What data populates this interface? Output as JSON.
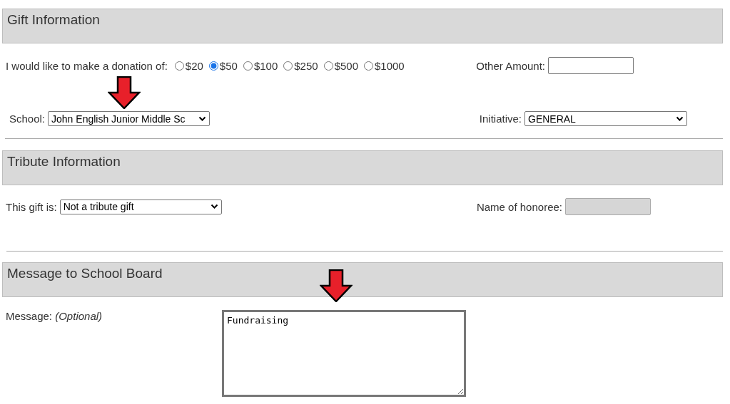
{
  "gift": {
    "title": "Gift Information",
    "donation": {
      "label": "I would like to make a donation of:",
      "options": [
        {
          "label": "$20",
          "selected": false
        },
        {
          "label": "$50",
          "selected": true
        },
        {
          "label": "$100",
          "selected": false
        },
        {
          "label": "$250",
          "selected": false
        },
        {
          "label": "$500",
          "selected": false
        },
        {
          "label": "$1000",
          "selected": false
        }
      ]
    },
    "other_amount": {
      "label": "Other Amount:"
    },
    "school": {
      "label": "School:",
      "value": "John English Junior Middle Sc"
    },
    "initiative": {
      "label": "Initiative:",
      "value": "GENERAL"
    }
  },
  "tribute": {
    "title": "Tribute Information",
    "gift_type": {
      "label": "This gift is:",
      "value": "Not a tribute gift"
    },
    "honoree": {
      "label": "Name of honoree:",
      "disabled": true
    }
  },
  "message": {
    "title": "Message to School Board",
    "label": "Message: *(Optional)*",
    "value": "Fundraising"
  }
}
